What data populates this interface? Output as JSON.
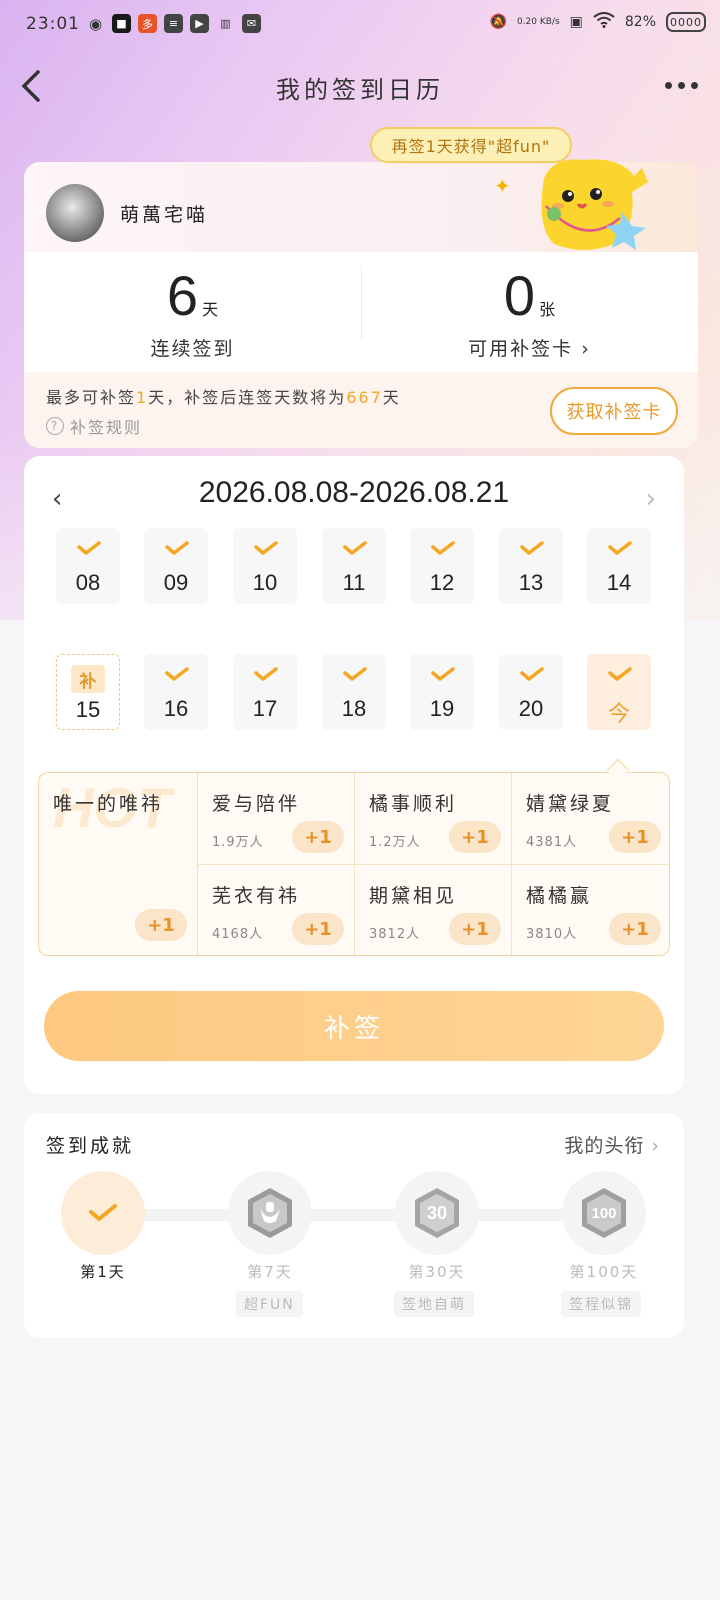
{
  "status": {
    "time": "23:01",
    "battery": "82%",
    "battery_box": "0000",
    "net_speed": "0.20 KB/s"
  },
  "header": {
    "title": "我的签到日历"
  },
  "bubble": {
    "text": "再签1天获得\"超fun\""
  },
  "user": {
    "name": "萌萬宅喵"
  },
  "stats": {
    "streak": {
      "value": "6",
      "unit": "天",
      "label": "连续签到"
    },
    "cards": {
      "value": "0",
      "unit": "张",
      "label": "可用补签卡"
    }
  },
  "tip": {
    "prefix": "最多可补签",
    "n": "1",
    "mid": "天，补签后连签天数将为",
    "total": "667",
    "suffix": "天",
    "rule": "补签规则",
    "get_card": "获取补签卡"
  },
  "calendar": {
    "range": "2026.08.08-2026.08.21",
    "days": [
      "08",
      "09",
      "10",
      "11",
      "12",
      "13",
      "14",
      "15",
      "16",
      "17",
      "18",
      "19",
      "20",
      "今"
    ],
    "makeup_tag": "补"
  },
  "topics": {
    "hot": "HOT",
    "featured": {
      "name": "唯一的唯祎",
      "plus": "+1"
    },
    "items": [
      {
        "name": "爱与陪伴",
        "people": "1.9万人",
        "plus": "+1"
      },
      {
        "name": "橘事顺利",
        "people": "1.2万人",
        "plus": "+1"
      },
      {
        "name": "婧黛绿夏",
        "people": "4381人",
        "plus": "+1"
      },
      {
        "name": "芜衣有祎",
        "people": "4168人",
        "plus": "+1"
      },
      {
        "name": "期黛相见",
        "people": "3812人",
        "plus": "+1"
      },
      {
        "name": "橘橘赢",
        "people": "3810人",
        "plus": "+1"
      }
    ]
  },
  "makeup_button": "补签",
  "achievements": {
    "title": "签到成就",
    "link": "我的头衔",
    "levels": [
      {
        "label": "第1天",
        "sub": ""
      },
      {
        "label": "第7天",
        "sub": "超FUN"
      },
      {
        "label": "第30天",
        "sub": "签地自萌"
      },
      {
        "label": "第100天",
        "sub": "签程似锦"
      }
    ]
  },
  "colors": {
    "accent": "#f5a623",
    "button": "#fdc880"
  }
}
